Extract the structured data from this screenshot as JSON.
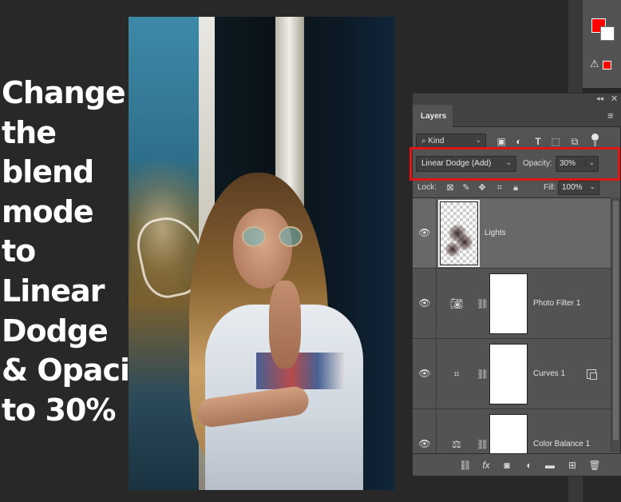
{
  "instruction": {
    "lines": [
      "Change",
      "the",
      "blend",
      "mode",
      "to",
      "Linear",
      "Dodge",
      "& Opacity",
      "to 30%"
    ]
  },
  "photo": {
    "description_icon": "portrait-photo"
  },
  "color_panel": {
    "foreground_color": "#ff0000",
    "background_color": "#ffffff"
  },
  "layers_panel": {
    "tab_label": "Layers",
    "filter": {
      "kind_label": "Kind"
    },
    "blend_mode": "Linear Dodge (Add)",
    "opacity_label": "Opacity:",
    "opacity_value": "30%",
    "lock_label": "Lock:",
    "fill_label": "Fill:",
    "fill_value": "100%",
    "layers": [
      {
        "name": "Lights",
        "type": "pixel",
        "selected": true
      },
      {
        "name": "Photo Filter 1",
        "type": "adjustment",
        "icon": "camera-filter-icon"
      },
      {
        "name": "Curves 1",
        "type": "adjustment",
        "icon": "curves-icon"
      },
      {
        "name": "Color Balance 1",
        "type": "adjustment",
        "icon": "balance-icon"
      }
    ]
  },
  "colors": {
    "highlight": "#e01414",
    "panel_bg": "#535353",
    "selected_row": "#686868"
  }
}
